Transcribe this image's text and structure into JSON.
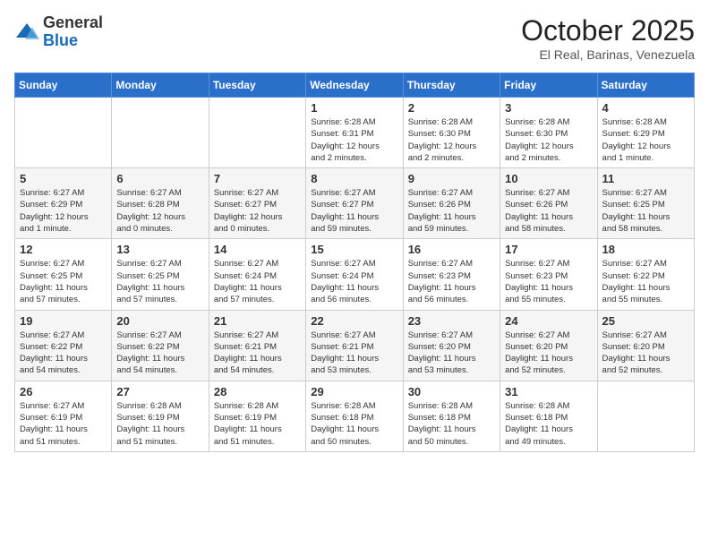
{
  "logo": {
    "general": "General",
    "blue": "Blue"
  },
  "header": {
    "month": "October 2025",
    "location": "El Real, Barinas, Venezuela"
  },
  "days_of_week": [
    "Sunday",
    "Monday",
    "Tuesday",
    "Wednesday",
    "Thursday",
    "Friday",
    "Saturday"
  ],
  "weeks": [
    [
      {
        "day": "",
        "info": ""
      },
      {
        "day": "",
        "info": ""
      },
      {
        "day": "",
        "info": ""
      },
      {
        "day": "1",
        "info": "Sunrise: 6:28 AM\nSunset: 6:31 PM\nDaylight: 12 hours\nand 2 minutes."
      },
      {
        "day": "2",
        "info": "Sunrise: 6:28 AM\nSunset: 6:30 PM\nDaylight: 12 hours\nand 2 minutes."
      },
      {
        "day": "3",
        "info": "Sunrise: 6:28 AM\nSunset: 6:30 PM\nDaylight: 12 hours\nand 2 minutes."
      },
      {
        "day": "4",
        "info": "Sunrise: 6:28 AM\nSunset: 6:29 PM\nDaylight: 12 hours\nand 1 minute."
      }
    ],
    [
      {
        "day": "5",
        "info": "Sunrise: 6:27 AM\nSunset: 6:29 PM\nDaylight: 12 hours\nand 1 minute."
      },
      {
        "day": "6",
        "info": "Sunrise: 6:27 AM\nSunset: 6:28 PM\nDaylight: 12 hours\nand 0 minutes."
      },
      {
        "day": "7",
        "info": "Sunrise: 6:27 AM\nSunset: 6:27 PM\nDaylight: 12 hours\nand 0 minutes."
      },
      {
        "day": "8",
        "info": "Sunrise: 6:27 AM\nSunset: 6:27 PM\nDaylight: 11 hours\nand 59 minutes."
      },
      {
        "day": "9",
        "info": "Sunrise: 6:27 AM\nSunset: 6:26 PM\nDaylight: 11 hours\nand 59 minutes."
      },
      {
        "day": "10",
        "info": "Sunrise: 6:27 AM\nSunset: 6:26 PM\nDaylight: 11 hours\nand 58 minutes."
      },
      {
        "day": "11",
        "info": "Sunrise: 6:27 AM\nSunset: 6:25 PM\nDaylight: 11 hours\nand 58 minutes."
      }
    ],
    [
      {
        "day": "12",
        "info": "Sunrise: 6:27 AM\nSunset: 6:25 PM\nDaylight: 11 hours\nand 57 minutes."
      },
      {
        "day": "13",
        "info": "Sunrise: 6:27 AM\nSunset: 6:25 PM\nDaylight: 11 hours\nand 57 minutes."
      },
      {
        "day": "14",
        "info": "Sunrise: 6:27 AM\nSunset: 6:24 PM\nDaylight: 11 hours\nand 57 minutes."
      },
      {
        "day": "15",
        "info": "Sunrise: 6:27 AM\nSunset: 6:24 PM\nDaylight: 11 hours\nand 56 minutes."
      },
      {
        "day": "16",
        "info": "Sunrise: 6:27 AM\nSunset: 6:23 PM\nDaylight: 11 hours\nand 56 minutes."
      },
      {
        "day": "17",
        "info": "Sunrise: 6:27 AM\nSunset: 6:23 PM\nDaylight: 11 hours\nand 55 minutes."
      },
      {
        "day": "18",
        "info": "Sunrise: 6:27 AM\nSunset: 6:22 PM\nDaylight: 11 hours\nand 55 minutes."
      }
    ],
    [
      {
        "day": "19",
        "info": "Sunrise: 6:27 AM\nSunset: 6:22 PM\nDaylight: 11 hours\nand 54 minutes."
      },
      {
        "day": "20",
        "info": "Sunrise: 6:27 AM\nSunset: 6:22 PM\nDaylight: 11 hours\nand 54 minutes."
      },
      {
        "day": "21",
        "info": "Sunrise: 6:27 AM\nSunset: 6:21 PM\nDaylight: 11 hours\nand 54 minutes."
      },
      {
        "day": "22",
        "info": "Sunrise: 6:27 AM\nSunset: 6:21 PM\nDaylight: 11 hours\nand 53 minutes."
      },
      {
        "day": "23",
        "info": "Sunrise: 6:27 AM\nSunset: 6:20 PM\nDaylight: 11 hours\nand 53 minutes."
      },
      {
        "day": "24",
        "info": "Sunrise: 6:27 AM\nSunset: 6:20 PM\nDaylight: 11 hours\nand 52 minutes."
      },
      {
        "day": "25",
        "info": "Sunrise: 6:27 AM\nSunset: 6:20 PM\nDaylight: 11 hours\nand 52 minutes."
      }
    ],
    [
      {
        "day": "26",
        "info": "Sunrise: 6:27 AM\nSunset: 6:19 PM\nDaylight: 11 hours\nand 51 minutes."
      },
      {
        "day": "27",
        "info": "Sunrise: 6:28 AM\nSunset: 6:19 PM\nDaylight: 11 hours\nand 51 minutes."
      },
      {
        "day": "28",
        "info": "Sunrise: 6:28 AM\nSunset: 6:19 PM\nDaylight: 11 hours\nand 51 minutes."
      },
      {
        "day": "29",
        "info": "Sunrise: 6:28 AM\nSunset: 6:18 PM\nDaylight: 11 hours\nand 50 minutes."
      },
      {
        "day": "30",
        "info": "Sunrise: 6:28 AM\nSunset: 6:18 PM\nDaylight: 11 hours\nand 50 minutes."
      },
      {
        "day": "31",
        "info": "Sunrise: 6:28 AM\nSunset: 6:18 PM\nDaylight: 11 hours\nand 49 minutes."
      },
      {
        "day": "",
        "info": ""
      }
    ]
  ]
}
